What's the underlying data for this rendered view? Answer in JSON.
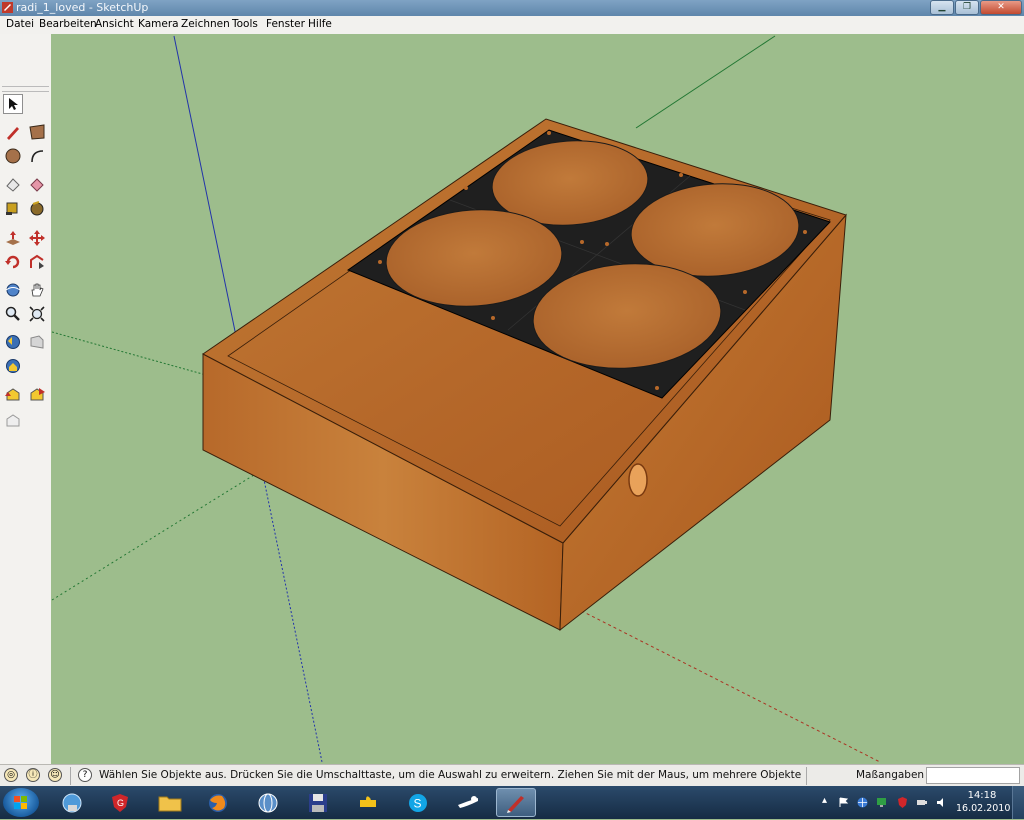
{
  "window": {
    "title": "radi_1_loved - SketchUp",
    "minimize_icon": "minimize-icon",
    "maximize_icon": "maximize-icon",
    "close_icon": "close-icon"
  },
  "menu": {
    "items": [
      "Datei",
      "Bearbeiten",
      "Ansicht",
      "Kamera",
      "Zeichnen",
      "Tools",
      "Fenster",
      "Hilfe"
    ]
  },
  "toolbar": {
    "tools": [
      "select-tool",
      "line-tool",
      "rectangle-tool",
      "circle-tool",
      "arc-tool",
      "eraser-tool",
      "paint-bucket-tool",
      "tape-measure-tool",
      "dimension-tool",
      "push-pull-tool",
      "move-tool",
      "rotate-tool",
      "follow-me-tool",
      "orbit-tool",
      "pan-tool",
      "zoom-tool",
      "zoom-extents-tool",
      "previous-view-tool",
      "next-view-tool",
      "walk-tool",
      "look-around-tool",
      "position-camera-tool"
    ]
  },
  "status": {
    "message": "Wählen Sie Objekte aus. Drücken Sie die Umschalttaste, um die Auswahl zu erweitern. Ziehen Sie mit der Maus, um mehrere Objekte",
    "measurements_label": "Maßangaben",
    "measurements_value": ""
  },
  "taskbar": {
    "apps": [
      "start-orb",
      "windows-explorer",
      "antivirus",
      "file-manager",
      "firefox",
      "network-tool",
      "save-disk",
      "puzzle-app",
      "skype",
      "steam",
      "sketchup"
    ],
    "clock_time": "14:18",
    "clock_date": "16.02.2010"
  },
  "colors": {
    "viewport_bg": "#9dbd8c",
    "wood": "#b8692a",
    "speaker_plate": "#1f1f1f",
    "axis_blue": "#2233aa",
    "axis_red": "#aa3322",
    "axis_green": "#227733"
  }
}
